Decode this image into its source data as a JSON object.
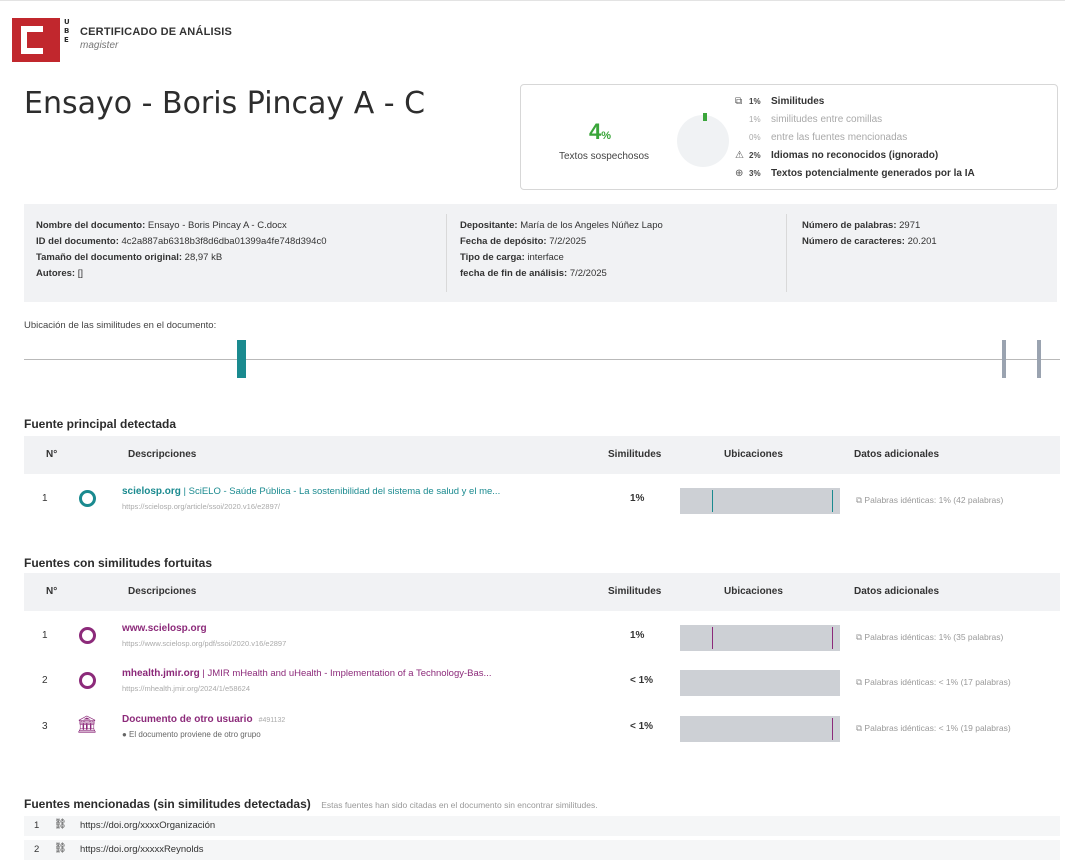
{
  "header": {
    "logo_side_letters": "U\nB\nE",
    "certificate_title": "CERTIFICADO DE ANÁLISIS",
    "certificate_subtitle": "magister"
  },
  "document_title": "Ensayo - Boris Pincay A - C",
  "summary": {
    "suspicious_percent": "4",
    "suspicious_percent_sign": "%",
    "suspicious_label": "Textos sospechosos",
    "rows": [
      {
        "icon": "copy-icon",
        "percent": "1%",
        "label": "Similitudes",
        "muted": false
      },
      {
        "icon": "",
        "percent": "1%",
        "label": "similitudes entre comillas",
        "muted": true
      },
      {
        "icon": "",
        "percent": "0%",
        "label": "entre las fuentes mencionadas",
        "muted": true
      },
      {
        "icon": "warning-icon",
        "percent": "2%",
        "label": "Idiomas no reconocidos (ignorado)",
        "muted": false
      },
      {
        "icon": "ai-icon",
        "percent": "3%",
        "label": "Textos potencialmente generados por la IA",
        "muted": false
      }
    ],
    "donut_value": 0.04
  },
  "meta": {
    "col1": [
      {
        "k": "Nombre del documento:",
        "v": "Ensayo - Boris Pincay A - C.docx"
      },
      {
        "k": "ID del documento:",
        "v": "4c2a887ab6318b3f8d6dba01399a4fe748d394c0"
      },
      {
        "k": "Tamaño del documento original:",
        "v": "28,97 kB"
      },
      {
        "k": "Autores:",
        "v": "[]"
      }
    ],
    "col2": [
      {
        "k": "Depositante:",
        "v": "María de los Angeles Núñez Lapo"
      },
      {
        "k": "Fecha de depósito:",
        "v": "7/2/2025"
      },
      {
        "k": "Tipo de carga:",
        "v": "interface"
      },
      {
        "k": "fecha de fin de análisis:",
        "v": "7/2/2025"
      }
    ],
    "col3": [
      {
        "k": "Número de palabras:",
        "v": "2971"
      },
      {
        "k": "Número de caracteres:",
        "v": "20.201"
      }
    ]
  },
  "location": {
    "label": "Ubicación de las similitudes en el documento:",
    "markers": [
      {
        "pos": 0.21,
        "color": "#1a8a8f"
      },
      {
        "pos": 0.946,
        "color": "#9aa3b0"
      },
      {
        "pos": 0.98,
        "color": "#9aa3b0"
      }
    ]
  },
  "table_headers": {
    "num": "N°",
    "desc": "Descripciones",
    "sim": "Similitudes",
    "loc": "Ubicaciones",
    "extra": "Datos adicionales"
  },
  "main_source": {
    "title": "Fuente principal detectada",
    "rows": [
      {
        "num": "1",
        "domain": "scielosp.org",
        "rest": " | SciELO - Saúde Pública - La sostenibilidad del sistema de salud y el me...",
        "url": "https://scielosp.org/article/ssoi/2020.v16/e2897/",
        "similarity": "1%",
        "extra": "Palabras idénticas: 1% (42 palabras)",
        "color": "#1a8a8f",
        "ticks": [
          0.2,
          0.95
        ]
      }
    ]
  },
  "fortuitous_sources": {
    "title": "Fuentes con similitudes fortuitas",
    "rows": [
      {
        "num": "1",
        "domain": "www.scielosp.org",
        "rest": "",
        "url": "https://www.scielosp.org/pdf/ssoi/2020.v16/e2897",
        "similarity": "1%",
        "extra": "Palabras idénticas: 1% (35 palabras)",
        "color": "#8c2a7a",
        "ticks": [
          0.2,
          0.95
        ],
        "kind": "globe"
      },
      {
        "num": "2",
        "domain": "mhealth.jmir.org",
        "rest": " | JMIR mHealth and uHealth - Implementation of a Technology-Bas...",
        "url": "https://mhealth.jmir.org/2024/1/e58624",
        "similarity": "< 1%",
        "extra": "Palabras idénticas: < 1% (17 palabras)",
        "color": "#8c2a7a",
        "ticks": [],
        "kind": "globe"
      },
      {
        "num": "3",
        "domain": "Documento de otro usuario",
        "rest": "",
        "badge": "#491132",
        "url": "El documento proviene de otro grupo",
        "similarity": "< 1%",
        "extra": "Palabras idénticas: < 1% (19 palabras)",
        "color": "#8c2a7a",
        "ticks": [
          0.95
        ],
        "kind": "institution"
      }
    ]
  },
  "mentioned_sources": {
    "title": "Fuentes mencionadas (sin similitudes detectadas)",
    "note": "Estas fuentes han sido citadas en el documento sin encontrar similitudes.",
    "rows": [
      {
        "num": "1",
        "url": "https://doi.org/xxxxOrganización"
      },
      {
        "num": "2",
        "url": "https://doi.org/xxxxxReynolds"
      }
    ]
  }
}
